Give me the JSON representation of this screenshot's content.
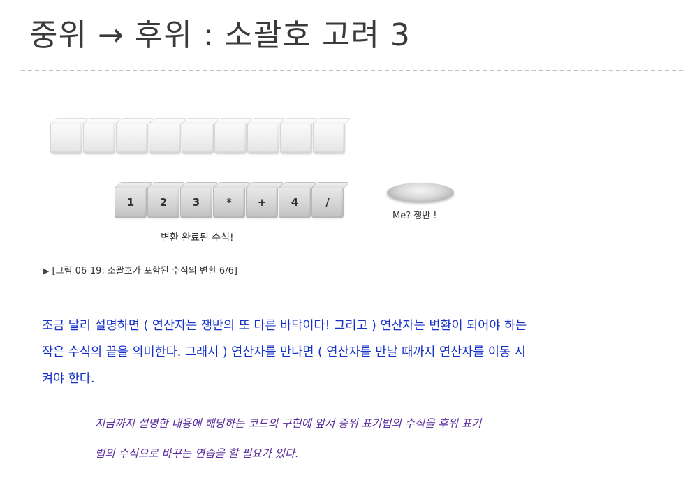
{
  "slide": {
    "title": "중위 → 후위 : 소괄호 고려 3"
  },
  "figure": {
    "empty_cube_count": 9,
    "expression_tokens": [
      "1",
      "2",
      "3",
      "*",
      "+",
      "4",
      "/"
    ],
    "tray_label": "Me? 쟁반 !",
    "converted_label": "변환 완료된 수식!",
    "caption_marker": "▶",
    "caption": "[그림 06-19: 소괄호가 포함된 수식의 변환 6/6]"
  },
  "body": {
    "line1": "조금 달리 설명하면 ( 연산자는 쟁반의 또 다른 바닥이다! 그리고 ) 연산자는 변환이 되어야 하는",
    "line2": "작은 수식의 끝을 의미한다. 그래서 ) 연산자를 만나면 ( 연산자를 만날 때까지 연산자를 이동 시",
    "line3": "켜야 한다."
  },
  "note": {
    "line1": "지금까지 설명한 내용에 해당하는 코드의 구현에 앞서 중위 표기법의 수식을 후위 표기",
    "line2": "법의 수식으로 바꾸는 연습을 할 필요가 있다."
  },
  "colors": {
    "title": "#3a3a3a",
    "body_text": "#1530c8",
    "note_text": "#5b2c9c",
    "divider": "#bfbfbf"
  }
}
